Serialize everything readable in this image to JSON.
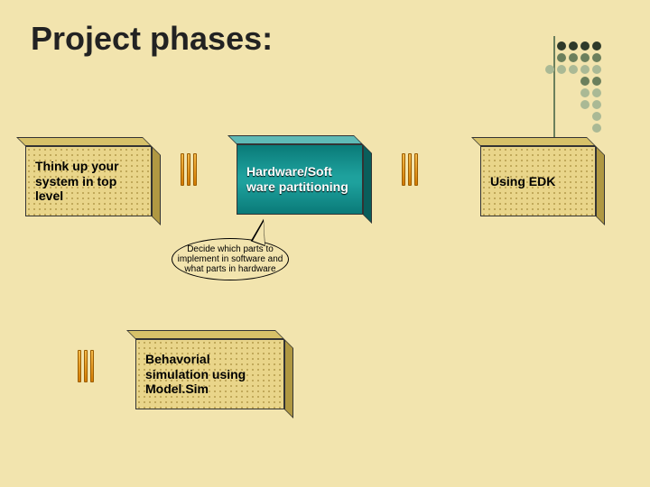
{
  "title": "Project phases:",
  "boxes": {
    "think": "Think up your system in top level",
    "partition": "Hardware/Soft ware partitioning",
    "edk": "Using EDK",
    "behavioral": "Behavorial simulation using Model.Sim"
  },
  "callout": "Decide which parts to implement in software and what parts in hardware"
}
